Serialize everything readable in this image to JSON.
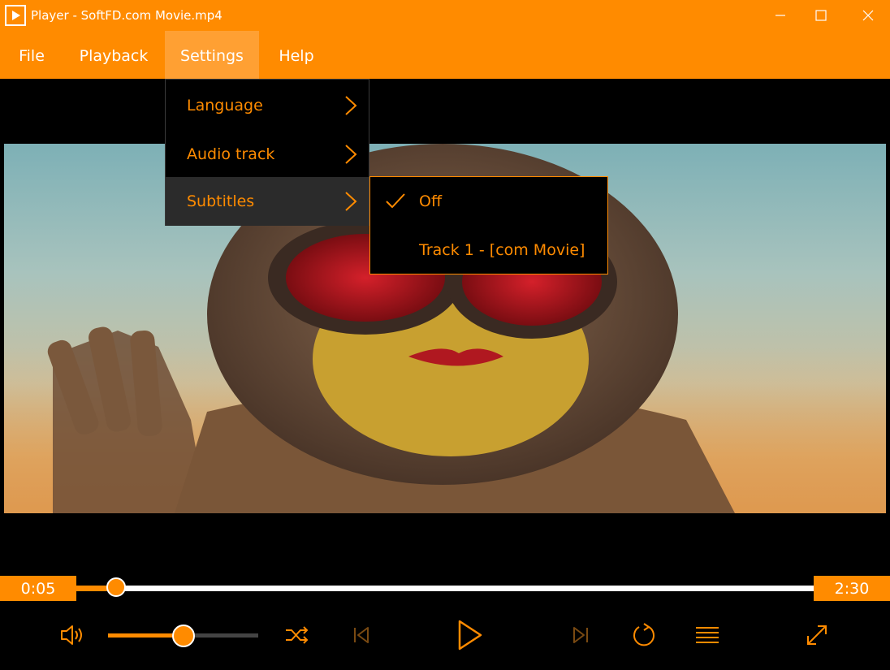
{
  "window": {
    "title": "Player - SoftFD.com Movie.mp4",
    "app_icon": "play-icon"
  },
  "window_controls": [
    "minimize-icon",
    "maximize-icon",
    "close-icon"
  ],
  "menubar": {
    "items": [
      {
        "label": "File"
      },
      {
        "label": "Playback"
      },
      {
        "label": "Settings",
        "active": true
      },
      {
        "label": "Help"
      }
    ]
  },
  "settings_menu": {
    "items": [
      {
        "label": "Language",
        "icon": "chevron-right-icon"
      },
      {
        "label": "Audio track",
        "icon": "chevron-right-icon"
      },
      {
        "label": "Subtitles",
        "icon": "chevron-right-icon",
        "active": true
      }
    ]
  },
  "subtitles_menu": {
    "items": [
      {
        "label": "Off",
        "checked": true
      },
      {
        "label": "Track 1 - [com Movie]",
        "checked": false
      }
    ]
  },
  "seek": {
    "current_time": "0:05",
    "total_time": "2:30",
    "progress": 0.054
  },
  "controls": {
    "volume_level": 0.5,
    "icons": [
      "volume-icon",
      "shuffle-icon",
      "previous-icon",
      "play-icon",
      "next-icon",
      "repeat-icon",
      "playlist-icon",
      "fullscreen-icon"
    ]
  },
  "colors": {
    "accent": "#ff8b00",
    "background": "#000000",
    "menu_active": "#ffa033"
  }
}
